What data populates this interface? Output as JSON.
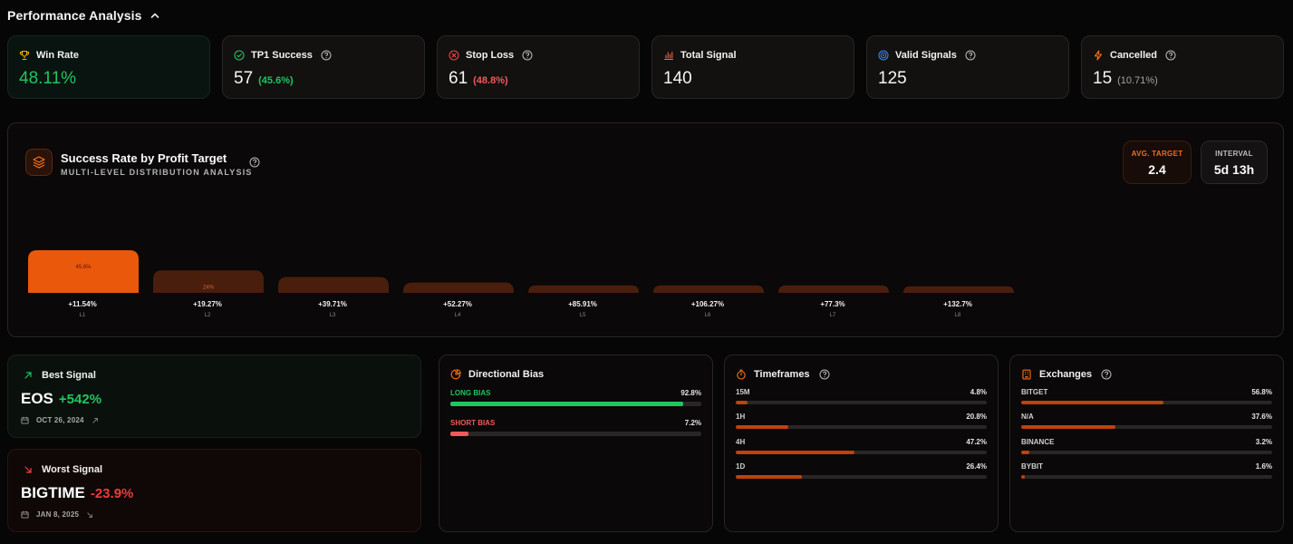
{
  "header": {
    "title": "Performance Analysis"
  },
  "stats": [
    {
      "label": "Win Rate",
      "value": "48.11%",
      "icon": "trophy-icon"
    },
    {
      "label": "TP1 Success",
      "value": "57",
      "pct": "(45.6%)",
      "icon": "check-circle-icon"
    },
    {
      "label": "Stop Loss",
      "value": "61",
      "pct": "(48.8%)",
      "icon": "x-circle-icon"
    },
    {
      "label": "Total Signal",
      "value": "140",
      "icon": "bar-chart-icon"
    },
    {
      "label": "Valid Signals",
      "value": "125",
      "icon": "target-icon"
    },
    {
      "label": "Cancelled",
      "value": "15",
      "pct": "(10.71%)",
      "icon": "lightning-icon"
    }
  ],
  "chart_panel": {
    "title": "Success Rate by Profit Target",
    "subtitle": "MULTI-LEVEL DISTRIBUTION ANALYSIS",
    "avg_target_label": "AVG. TARGET",
    "avg_target_value": "2.4",
    "interval_label": "INTERVAL",
    "interval_value": "5d 13h"
  },
  "chart_data": {
    "type": "bar",
    "categories": [
      "L1",
      "L2",
      "L3",
      "L4",
      "L5",
      "L6",
      "L7",
      "L8"
    ],
    "profit_labels": [
      "+11.54%",
      "+19.27%",
      "+39.71%",
      "+52.27%",
      "+85.91%",
      "+106.27%",
      "+77.3%",
      "+132.7%"
    ],
    "values": [
      45.6,
      24,
      17,
      11,
      8,
      8,
      8,
      7
    ],
    "data_labels": [
      "45.6%",
      "24%",
      "",
      "",
      "",
      "",
      "",
      ""
    ],
    "ylim": [
      0,
      45.6
    ],
    "colors": {
      "primary": "#ea580c",
      "muted": "#4a1e0c"
    }
  },
  "best_signal": {
    "label": "Best Signal",
    "coin": "EOS",
    "change": "+542%",
    "date": "OCT 26, 2024"
  },
  "worst_signal": {
    "label": "Worst Signal",
    "coin": "BIGTIME",
    "change": "-23.9%",
    "date": "JAN 8, 2025"
  },
  "directional_bias": {
    "title": "Directional Bias",
    "rows": [
      {
        "name": "LONG BIAS",
        "pct": "92.8%",
        "value": 92.8,
        "color": "#22c55e"
      },
      {
        "name": "SHORT BIAS",
        "pct": "7.2%",
        "value": 7.2,
        "color": "#f05a5a"
      }
    ]
  },
  "timeframes": {
    "title": "Timeframes",
    "rows": [
      {
        "name": "15M",
        "pct": "4.8%",
        "value": 4.8
      },
      {
        "name": "1H",
        "pct": "20.8%",
        "value": 20.8
      },
      {
        "name": "4H",
        "pct": "47.2%",
        "value": 47.2
      },
      {
        "name": "1D",
        "pct": "26.4%",
        "value": 26.4
      }
    ]
  },
  "exchanges": {
    "title": "Exchanges",
    "rows": [
      {
        "name": "BITGET",
        "pct": "56.8%",
        "value": 56.8
      },
      {
        "name": "N/A",
        "pct": "37.6%",
        "value": 37.6
      },
      {
        "name": "BINANCE",
        "pct": "3.2%",
        "value": 3.2
      },
      {
        "name": "BYBIT",
        "pct": "1.6%",
        "value": 1.6
      }
    ]
  },
  "colors": {
    "accent": "#ea580c",
    "green": "#22c55e",
    "red": "#f05a5a",
    "bar_track": "#2a2626",
    "bar_fill": "#c2410c"
  }
}
